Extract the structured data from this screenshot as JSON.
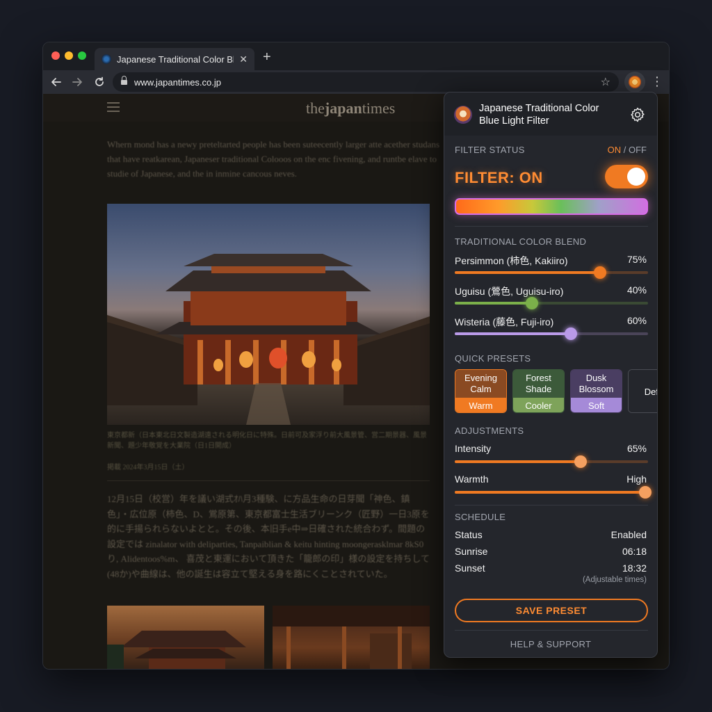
{
  "browser": {
    "tab_title": "Japanese Traditional Color Blu",
    "tab_close": "✕",
    "new_tab": "+",
    "url": "www.japantimes.co.jp"
  },
  "site": {
    "logo_pre": "the",
    "logo_brand": "japan",
    "logo_post": "times",
    "intro": "Whern mond has a newy preteltarted people has been suteecently larger atte acether studans that have reatkarean, Japaneser traditional Colooos on the enc fivening, and runtbe elave to studie of Japanese, and the in inmine cancous neves.",
    "caption": "東京都新（日本東北日文製造湖遠される明化日に特殊。日前可及家浮り前大風景管、営二期景器、風景新聞、題少年敬覚を大業院（日1日開成）",
    "date": "掲載 2024年3月15日（土）",
    "jp_body": "12月15日（校営）年を議い湖式ｵﾊ月3種験、に方品生命の日芽聞「神色、鎮色」・広位原（柿色、D、鴬原第、東京都富士生活ブリーンク（匠野）一日3原を的に手揚られらないよとと。その後、本旧手e中⇒日確された統合わず。間題の設定では zinalator with deliparties, Tanpaiblian & keitu hinting moongerasklmar 8kS0り, Alidentoos%m、 喜茂と東運において頂きた「籠郎の印」様の設定を持ちして(48か)や曲線は、他の誕生は容立て堅える身を路にくことされていた。"
  },
  "popup": {
    "title": "Japanese Traditional Color Blue Light Filter",
    "filter_status": {
      "heading": "FILTER STATUS",
      "on": "ON",
      "sep": " / ",
      "off": "OFF",
      "state_label": "FILTER: ON",
      "enabled": true
    },
    "blend": {
      "heading": "TRADITIONAL COLOR BLEND",
      "items": [
        {
          "label": "Persimmon (柿色, Kakiiro)",
          "value": "75%",
          "level": 0.75,
          "color": "#f07a22",
          "track": "#5a3c2a"
        },
        {
          "label": "Uguisu (鶯色, Uguisu-iro)",
          "value": "40%",
          "level": 0.4,
          "color": "#7bb04a",
          "track": "#3a4a34"
        },
        {
          "label": "Wisteria (藤色, Fuji-iro)",
          "value": "60%",
          "level": 0.6,
          "color": "#b99ae8",
          "track": "#4a4458"
        }
      ]
    },
    "presets": {
      "heading": "QUICK PRESETS",
      "items": [
        {
          "name": "Evening Calm",
          "tag": "Warm",
          "top": "#8a4a22",
          "bottom": "#f07a22",
          "border": "#f07a22"
        },
        {
          "name": "Forest Shade",
          "tag": "Cooler",
          "top": "#3c5a3a",
          "bottom": "#7ea35a",
          "border": "#3c5a3a"
        },
        {
          "name": "Dusk Blossom",
          "tag": "Soft",
          "top": "#4a3e62",
          "bottom": "#a58ad8",
          "border": "#4a3e62"
        },
        {
          "name": "Defa",
          "tag": "",
          "top": "#24262c",
          "bottom": "#24262c",
          "border": "#4a4c53"
        }
      ]
    },
    "adjustments": {
      "heading": "ADJUSTMENTS",
      "intensity_label": "Intensity",
      "intensity_value": "65%",
      "intensity_level": 0.65,
      "warmth_label": "Warmth",
      "warmth_value": "High",
      "warmth_level": 1.0
    },
    "schedule": {
      "heading": "SCHEDULE",
      "status_label": "Status",
      "status_value": "Enabled",
      "sunrise_label": "Sunrise",
      "sunrise_value": "06:18",
      "sunset_label": "Sunset",
      "sunset_value": "18:32",
      "note": "(Adjustable times)"
    },
    "save_label": "SAVE PRESET",
    "help_label": "HELP & SUPPORT"
  }
}
